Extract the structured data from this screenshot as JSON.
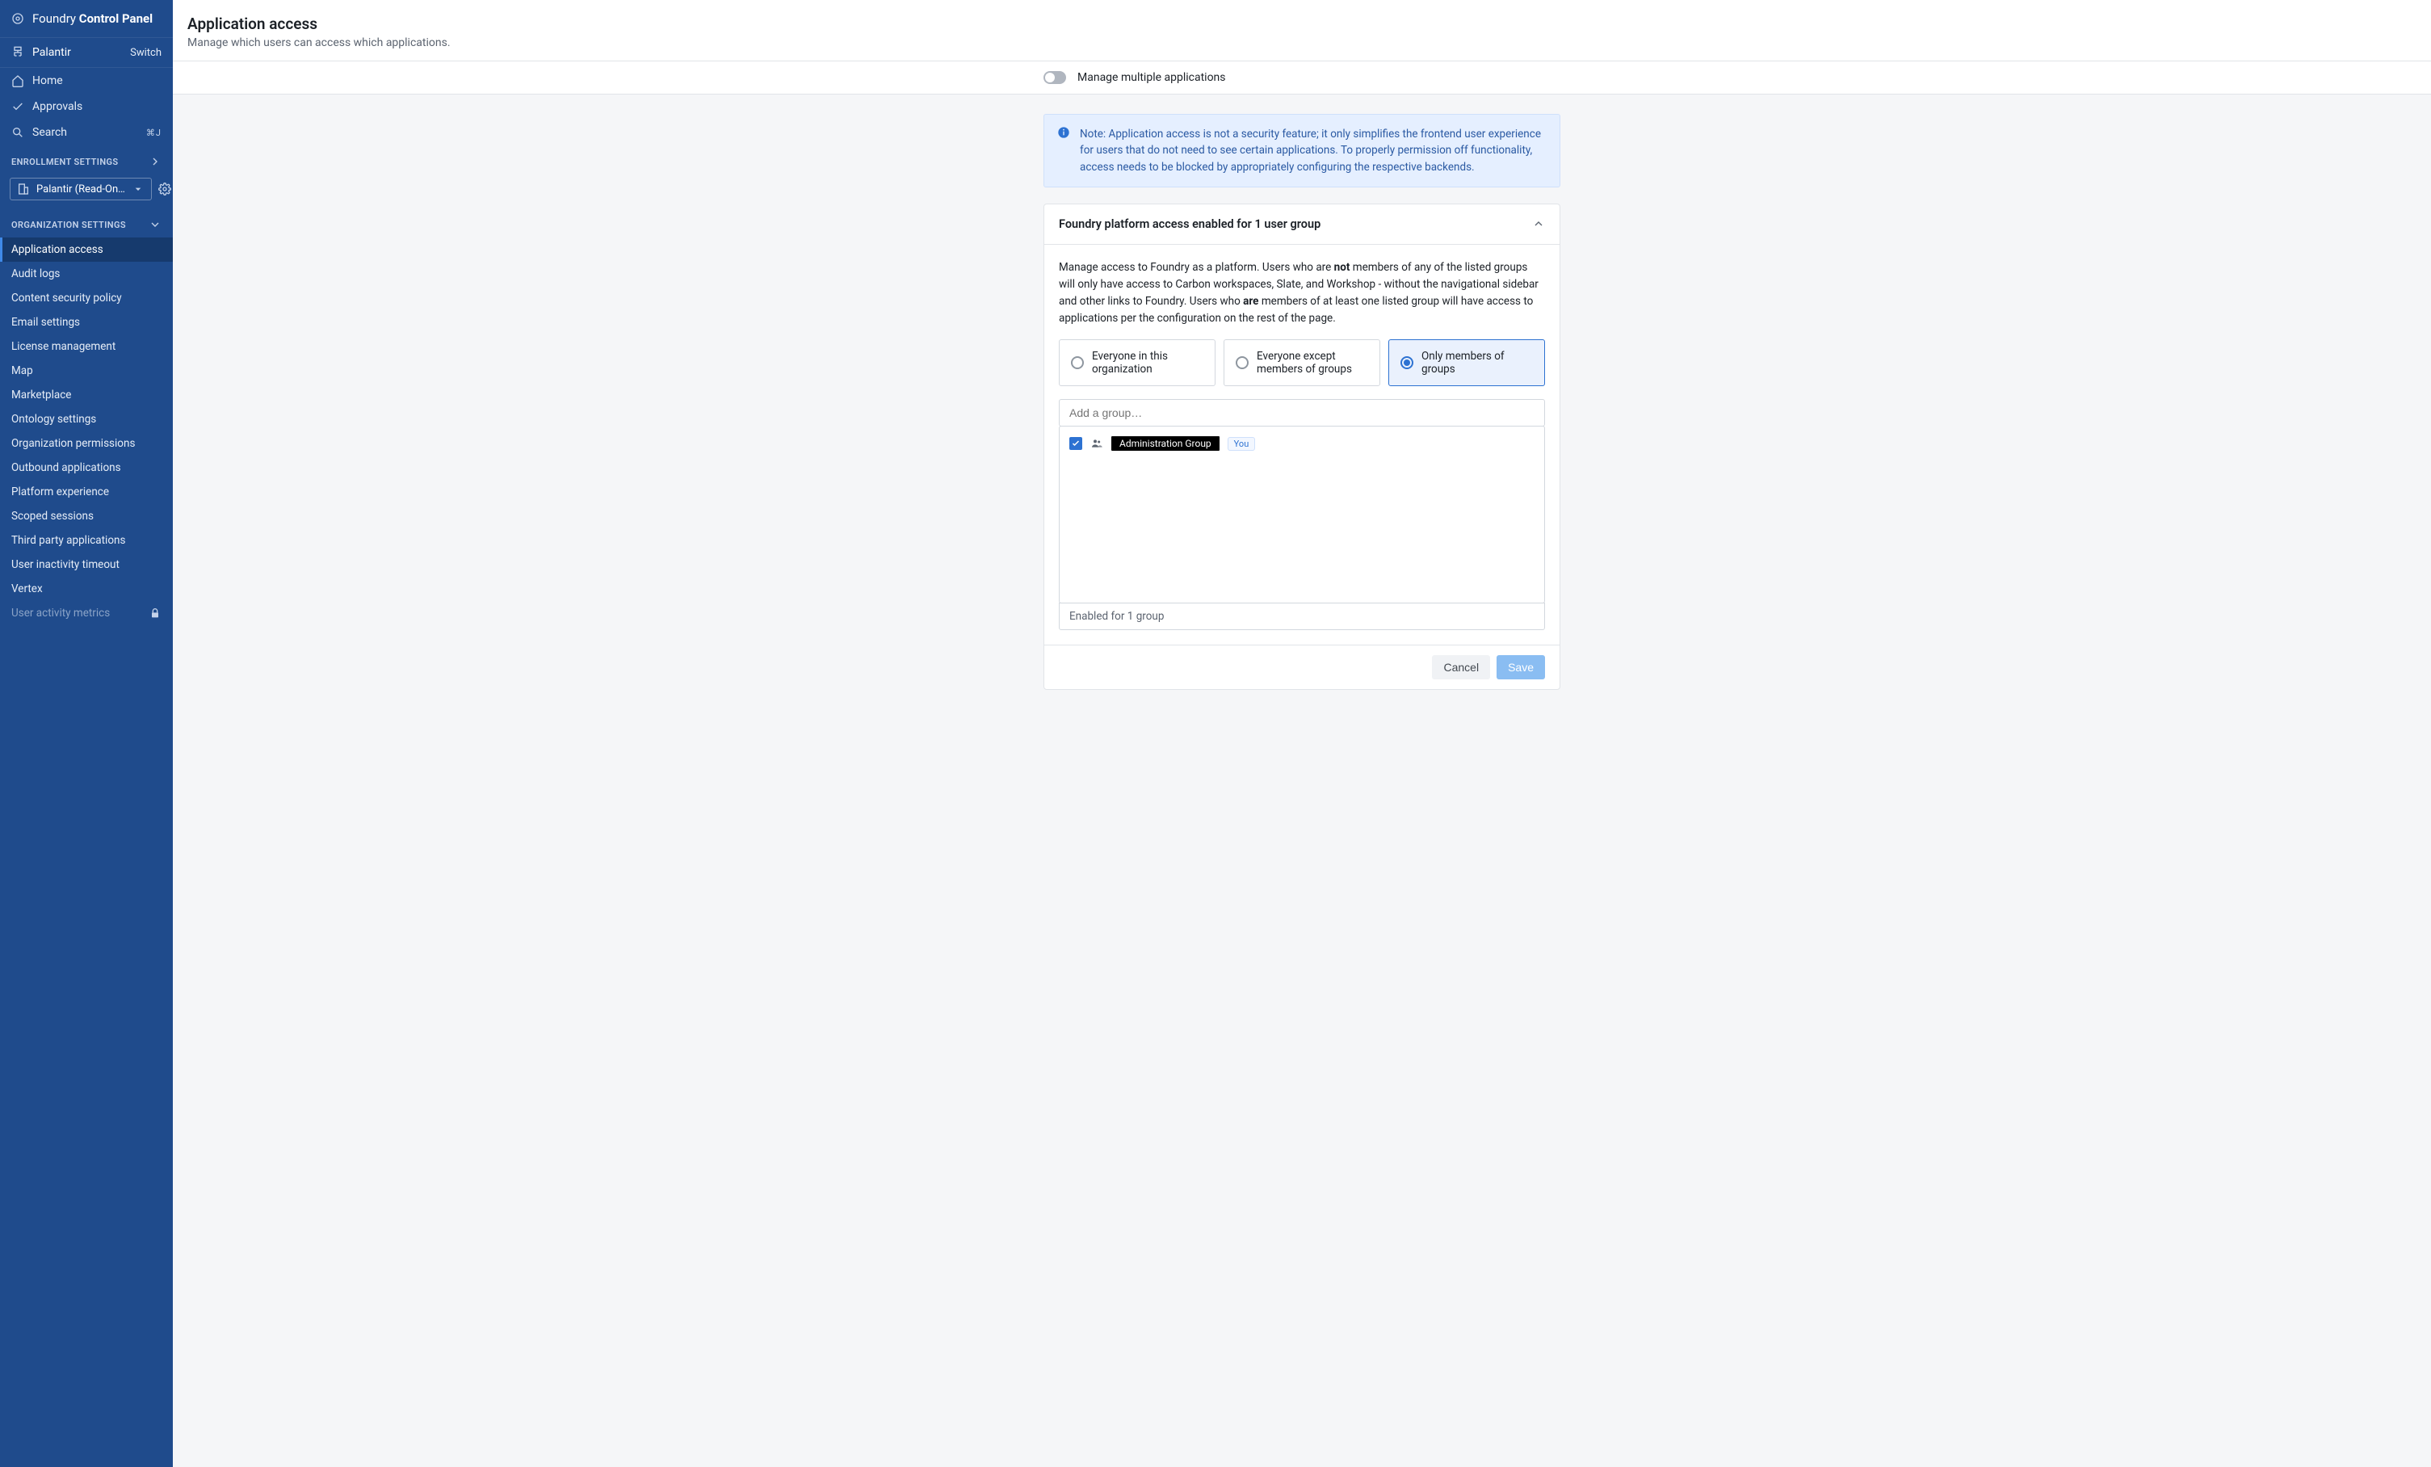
{
  "brand": {
    "light": "Foundry",
    "bold": "Control Panel"
  },
  "org": {
    "name": "Palantir",
    "switch_label": "Switch"
  },
  "top_nav": [
    {
      "label": "Home",
      "icon": "home"
    },
    {
      "label": "Approvals",
      "icon": "check"
    },
    {
      "label": "Search",
      "icon": "search",
      "shortcut": "⌘J"
    }
  ],
  "enrollment_header": "ENROLLMENT SETTINGS",
  "org_selector": "Palantir (Read-On…",
  "organization_header": "ORGANIZATION SETTINGS",
  "org_nav": [
    {
      "label": "Application access",
      "active": true
    },
    {
      "label": "Audit logs"
    },
    {
      "label": "Content security policy"
    },
    {
      "label": "Email settings"
    },
    {
      "label": "License management"
    },
    {
      "label": "Map"
    },
    {
      "label": "Marketplace"
    },
    {
      "label": "Ontology settings"
    },
    {
      "label": "Organization permissions"
    },
    {
      "label": "Outbound applications"
    },
    {
      "label": "Platform experience"
    },
    {
      "label": "Scoped sessions"
    },
    {
      "label": "Third party applications"
    },
    {
      "label": "User inactivity timeout"
    },
    {
      "label": "Vertex"
    },
    {
      "label": "User activity metrics",
      "locked": true
    }
  ],
  "page": {
    "title": "Application access",
    "subtitle": "Manage which users can access which applications."
  },
  "toggle": {
    "label": "Manage multiple applications",
    "value": false
  },
  "banner": {
    "text": "Note: Application access is not a security feature; it only simplifies the frontend user experience for users that do not need to see certain applications. To properly permission off functionality, access needs to be blocked by appropriately configuring the respective backends."
  },
  "panel": {
    "title": "Foundry platform access enabled for 1 user group",
    "explain_before": "Manage access to Foundry as a platform. Users who are ",
    "explain_not": "not",
    "explain_mid": " members of any of the listed groups will only have access to Carbon workspaces, Slate, and Workshop - without the navigational sidebar and other links to Foundry. Users who ",
    "explain_are": "are",
    "explain_after": " members of at least one listed group will have access to applications per the configuration on the rest of the page.",
    "options": [
      {
        "label": "Everyone in this organization",
        "selected": false
      },
      {
        "label": "Everyone except members of groups",
        "selected": false
      },
      {
        "label": "Only members of groups",
        "selected": true
      }
    ],
    "add_group_placeholder": "Add a group…",
    "groups": [
      {
        "label": "Administration Group",
        "checked": true,
        "you": true
      }
    ],
    "enabled_footer": "Enabled for 1 group",
    "you_label": "You"
  },
  "buttons": {
    "cancel": "Cancel",
    "save": "Save"
  }
}
